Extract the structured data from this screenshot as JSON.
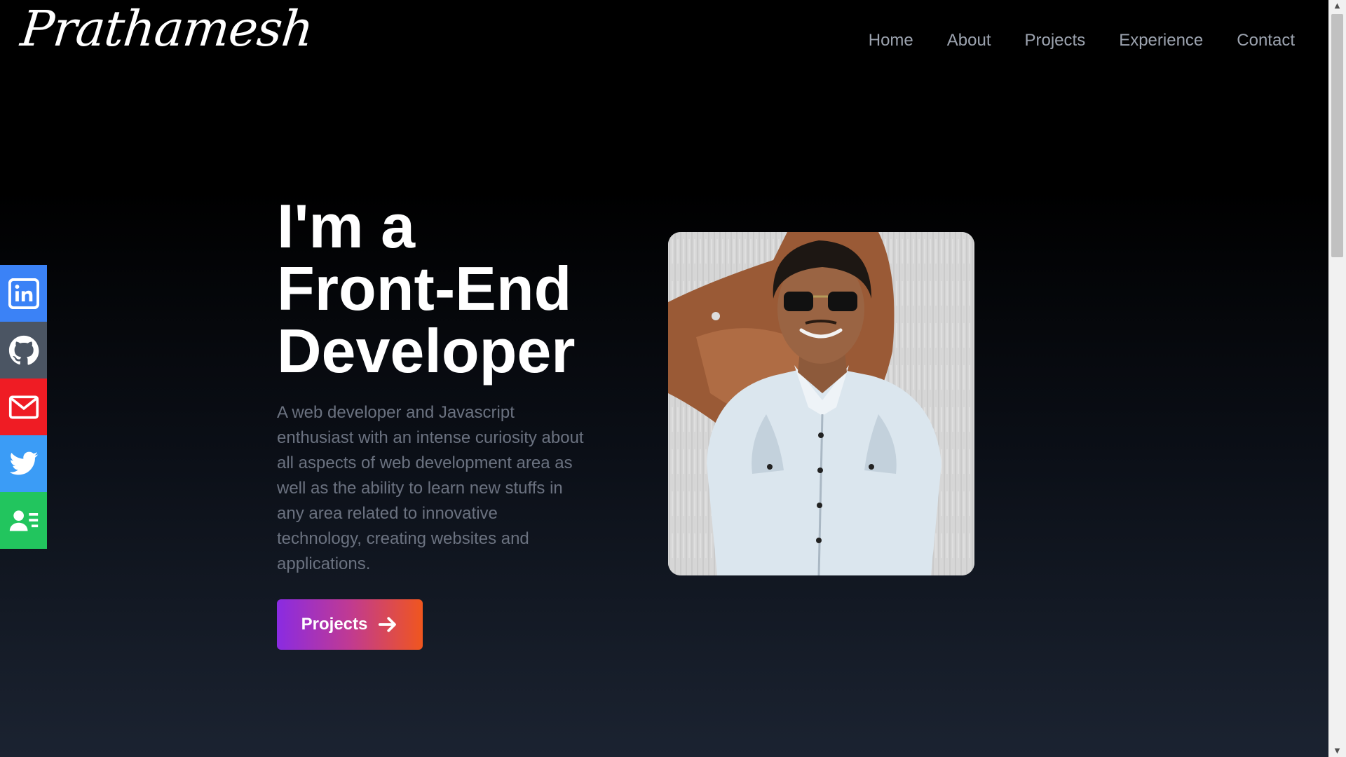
{
  "header": {
    "logo": "Prathamesh",
    "nav": [
      "Home",
      "About",
      "Projects",
      "Experience",
      "Contact"
    ]
  },
  "social": [
    {
      "name": "linkedin",
      "color": "#3b82f6"
    },
    {
      "name": "github",
      "color": "#4b5563"
    },
    {
      "name": "mail",
      "color": "#ef1c24"
    },
    {
      "name": "twitter",
      "color": "#3b9cf6"
    },
    {
      "name": "resume",
      "color": "#22c55e"
    }
  ],
  "hero": {
    "headline": [
      "I'm a",
      "Front-End",
      "Developer"
    ],
    "bio": "A web developer and Javascript enthusiast with an intense curiosity about all aspects of web development area as well as the ability to learn new stuffs in any area related to innovative technology, creating websites and applications.",
    "cta_label": "Projects"
  },
  "colors": {
    "background_top": "#000000",
    "background_bottom": "#1b2331",
    "cta_gradient_start": "#8a2be2",
    "cta_gradient_end": "#f0561e",
    "nav_text": "#9ca3af"
  }
}
